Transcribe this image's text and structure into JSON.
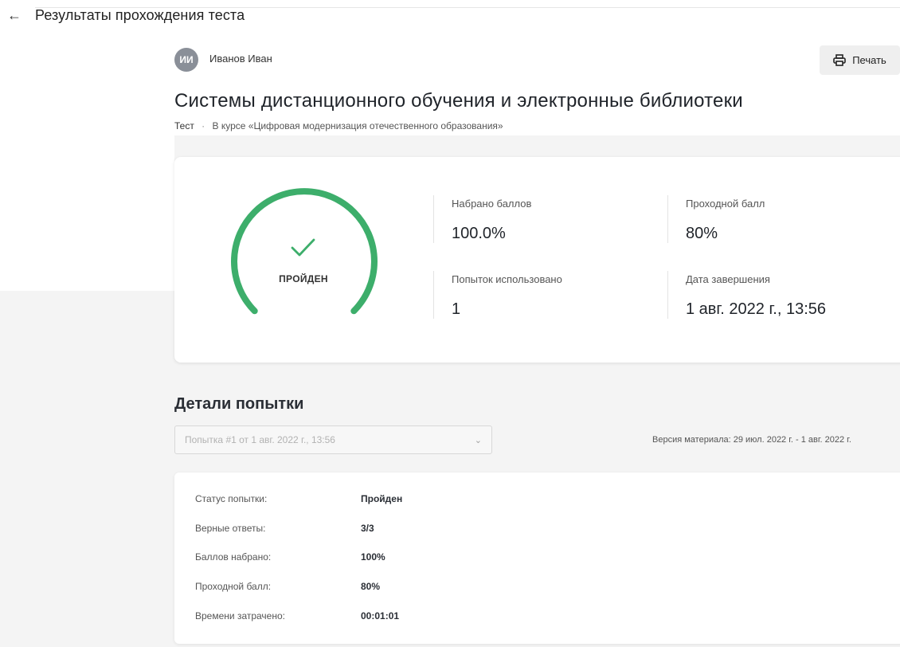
{
  "header": {
    "back_icon": "arrow-left-icon",
    "title": "Результаты прохождения теста"
  },
  "user": {
    "initials": "ИИ",
    "name": "Иванов Иван"
  },
  "print_button": {
    "icon": "printer-icon",
    "label": "Печать"
  },
  "course": {
    "title": "Системы дистанционного обучения и электронные библиотеки",
    "type": "Тест",
    "separator": "·",
    "course_ref": "В курсе «Цифровая модернизация отечественного образования»"
  },
  "result": {
    "status": "ПРОЙДЕН",
    "status_icon": "checkmark-icon",
    "gauge_progress": 1.0,
    "accent_color": "#3dae6b",
    "stats": {
      "score": {
        "label": "Набрано баллов",
        "value": "100.0%"
      },
      "passing": {
        "label": "Проходной балл",
        "value": "80%"
      },
      "attempts": {
        "label": "Попыток использовано",
        "value": "1"
      },
      "completed": {
        "label": "Дата завершения",
        "value": "1 авг. 2022 г., 13:56"
      }
    }
  },
  "details": {
    "title": "Детали попытки",
    "attempt_select": {
      "value": "Попытка #1 от 1 авг. 2022 г., 13:56",
      "icon": "chevron-down-icon"
    },
    "version": "Версия материала: 29 июл. 2022 г. - 1 авг. 2022 г.",
    "rows": [
      {
        "key": "Статус попытки:",
        "value": "Пройден"
      },
      {
        "key": "Верные ответы:",
        "value": "3/3"
      },
      {
        "key": "Баллов набрано:",
        "value": "100%"
      },
      {
        "key": "Проходной балл:",
        "value": "80%"
      },
      {
        "key": "Времени затрачено:",
        "value": "00:01:01"
      }
    ]
  }
}
